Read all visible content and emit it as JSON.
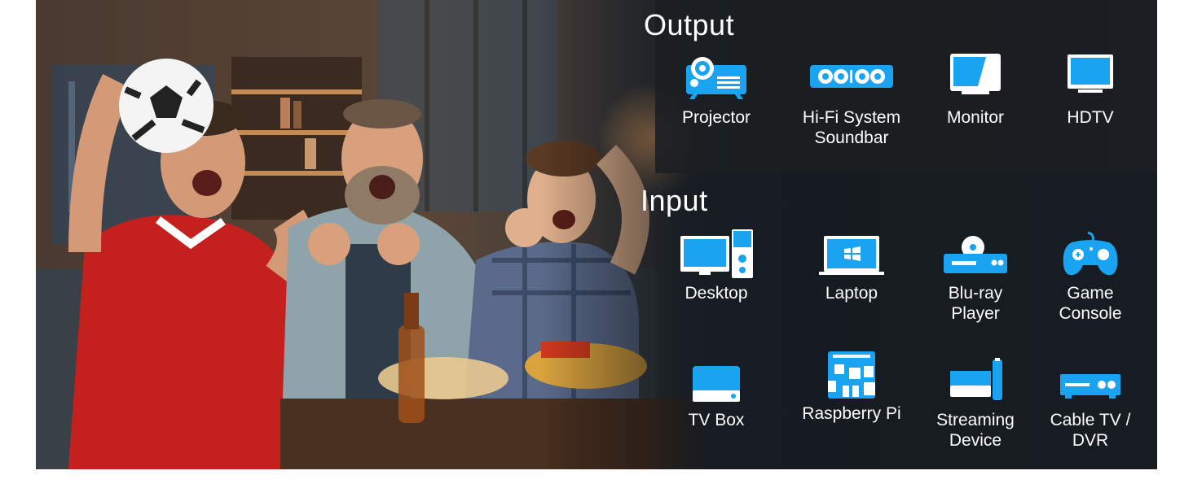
{
  "output": {
    "title": "Output",
    "devices": [
      {
        "label": "Projector",
        "icon": "projector-icon"
      },
      {
        "label": "Hi-Fi System Soundbar",
        "icon": "soundbar-icon"
      },
      {
        "label": "Monitor",
        "icon": "monitor-icon"
      },
      {
        "label": "HDTV",
        "icon": "hdtv-icon"
      }
    ]
  },
  "input": {
    "title": "Input",
    "devices": [
      {
        "label": "Desktop",
        "icon": "desktop-icon"
      },
      {
        "label": "Laptop",
        "icon": "laptop-icon"
      },
      {
        "label": "Blu-ray Player",
        "icon": "bluray-player-icon"
      },
      {
        "label": "Game Console",
        "icon": "game-console-icon"
      },
      {
        "label": "TV Box",
        "icon": "tv-box-icon"
      },
      {
        "label": "Raspberry Pi",
        "icon": "raspberry-pi-icon"
      },
      {
        "label": "Streaming Device",
        "icon": "streaming-device-icon"
      },
      {
        "label": "Cable TV / DVR",
        "icon": "cable-tv-dvr-icon"
      }
    ]
  },
  "colors": {
    "icon_blue": "#1aa3f0",
    "icon_white": "#ffffff",
    "panel_dark": "#1c1f22",
    "text": "#ffffff"
  },
  "photo": {
    "icon": "sports-fans-photo"
  }
}
